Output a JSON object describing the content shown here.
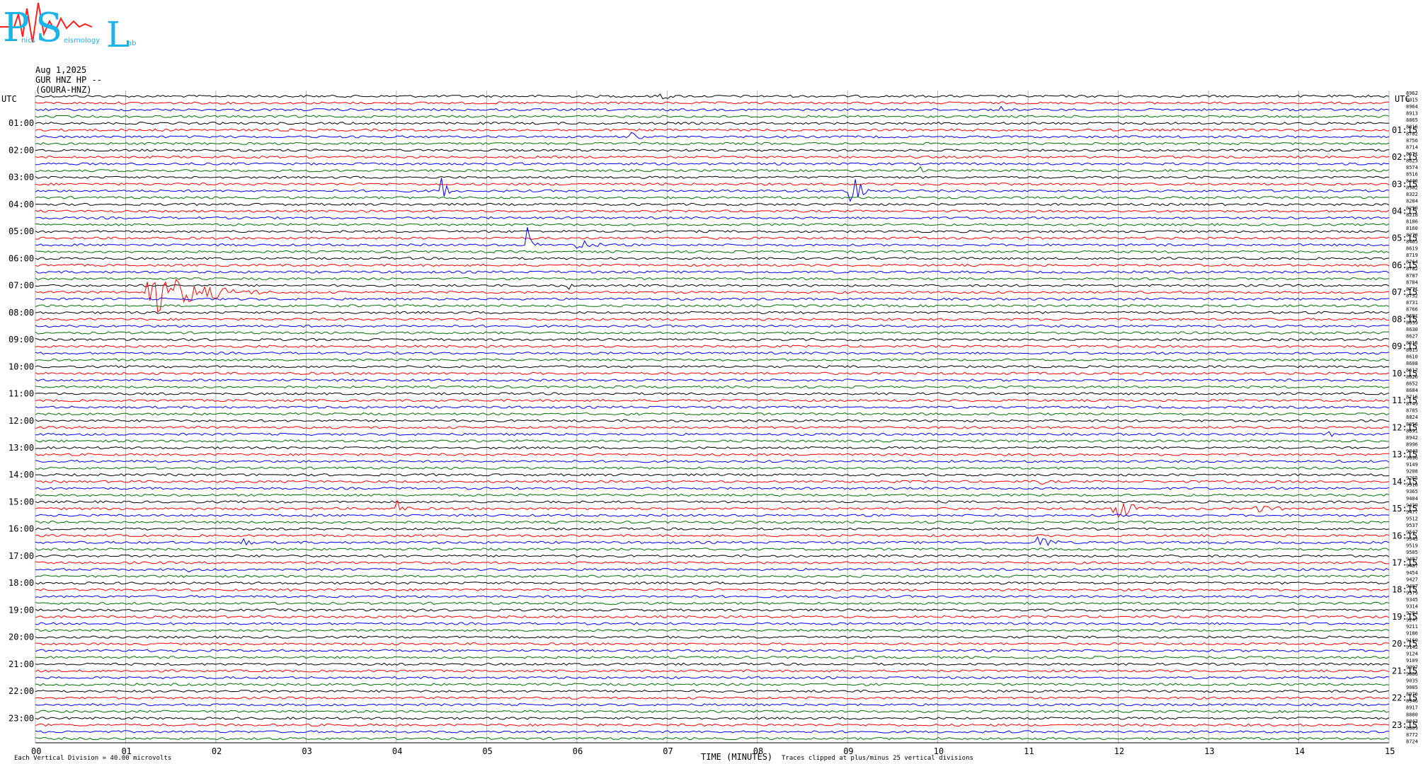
{
  "header": {
    "date": "Aug 1,2025",
    "channel": "GUR HNZ HP --",
    "station": "(GOURA-HNZ)"
  },
  "logo": {
    "letters": [
      "P",
      "S",
      "L"
    ],
    "text_fragment_1": "nics",
    "text_fragment_2": "eismology",
    "text_fragment_3": "ab"
  },
  "footer": {
    "division_note": "Each Vertical Division =    40.00 microvolts",
    "time_label": "TIME (MINUTES)",
    "clip_note": "Traces clipped at plus/minus 25 vertical divisions"
  },
  "colors": {
    "trace_cycle": [
      "#000000",
      "#ff0000",
      "#0000ff",
      "#007000"
    ],
    "grid": "#a0a0a0"
  },
  "chart_data": {
    "type": "line",
    "title": "",
    "xlabel": "TIME (MINUTES)",
    "xlim": [
      0,
      15
    ],
    "x_ticks": [
      "00",
      "01",
      "02",
      "03",
      "04",
      "05",
      "06",
      "07",
      "08",
      "09",
      "10",
      "11",
      "12",
      "13",
      "14",
      "15"
    ],
    "left_axis_label": "UTC",
    "right_axis_label": "UTC",
    "left_hour_labels": [
      "01:00",
      "02:00",
      "03:00",
      "04:00",
      "05:00",
      "06:00",
      "07:00",
      "08:00",
      "09:00",
      "10:00",
      "11:00",
      "12:00",
      "13:00",
      "14:00",
      "15:00",
      "16:00",
      "17:00",
      "18:00",
      "19:00",
      "20:00",
      "21:00",
      "22:00",
      "23:00"
    ],
    "right_hour_labels": [
      "01:15",
      "02:15",
      "03:15",
      "04:15",
      "05:15",
      "06:15",
      "07:15",
      "08:15",
      "09:15",
      "10:15",
      "11:15",
      "12:15",
      "13:15",
      "14:15",
      "15:15",
      "16:15",
      "17:15",
      "18:15",
      "19:15",
      "20:15",
      "21:15",
      "22:15",
      "23:15"
    ],
    "trace_count": 96,
    "trace_minutes": 15,
    "right_counts": [
      "8962",
      "9015",
      "8964",
      "8913",
      "8865",
      "8816",
      "8782",
      "8756",
      "8714",
      "8671",
      "8623",
      "8574",
      "8516",
      "8440",
      "8382",
      "8322",
      "8284",
      "8250",
      "8218",
      "8186",
      "8160",
      "8278",
      "8465",
      "8619",
      "8719",
      "8764",
      "8782",
      "8787",
      "8784",
      "8771",
      "8752",
      "8731",
      "8766",
      "8681",
      "8659",
      "8630",
      "8627",
      "8615",
      "8615",
      "8610",
      "8608",
      "8612",
      "8626",
      "8652",
      "8684",
      "8716",
      "8749",
      "8785",
      "8824",
      "8856",
      "8891",
      "8942",
      "8996",
      "9043",
      "9096",
      "9149",
      "9208",
      "9265",
      "9318",
      "9365",
      "9404",
      "9439",
      "9477",
      "9512",
      "9537",
      "9547",
      "9543",
      "9519",
      "9505",
      "9487",
      "9487",
      "9454",
      "9427",
      "9407",
      "9379",
      "9345",
      "9314",
      "9284",
      "9247",
      "9211",
      "9186",
      "9169",
      "9142",
      "9124",
      "9109",
      "9097",
      "9066",
      "9035",
      "9005",
      "8976",
      "8946",
      "8917",
      "8880",
      "8843",
      "8809",
      "8772",
      "8724"
    ],
    "events": [
      {
        "trace": 0,
        "minute": 6.9,
        "duration": 0.35,
        "amp": 9
      },
      {
        "trace": 2,
        "minute": 10.7,
        "duration": 0.2,
        "amp": 5
      },
      {
        "trace": 6,
        "minute": 6.6,
        "duration": 0.35,
        "amp": 7
      },
      {
        "trace": 11,
        "minute": 9.8,
        "duration": 0.25,
        "amp": 6
      },
      {
        "trace": 14,
        "minute": 9.0,
        "duration": 0.25,
        "amp": 70
      },
      {
        "trace": 14,
        "minute": 4.5,
        "duration": 0.15,
        "amp": 30
      },
      {
        "trace": 14,
        "minute": 8.5,
        "duration": 0.2,
        "amp": 6
      },
      {
        "trace": 22,
        "minute": 5.45,
        "duration": 0.15,
        "amp": 30
      },
      {
        "trace": 22,
        "minute": 6.0,
        "duration": 0.6,
        "amp": 10
      },
      {
        "trace": 28,
        "minute": 5.9,
        "duration": 0.15,
        "amp": 14
      },
      {
        "trace": 29,
        "minute": 1.2,
        "duration": 1.5,
        "amp": 40
      },
      {
        "trace": 50,
        "minute": 14.3,
        "duration": 0.25,
        "amp": 7
      },
      {
        "trace": 57,
        "minute": 11.1,
        "duration": 0.4,
        "amp": 6
      },
      {
        "trace": 61,
        "minute": 4.0,
        "duration": 0.25,
        "amp": 16
      },
      {
        "trace": 62,
        "minute": 10.6,
        "duration": 0.2,
        "amp": 5
      },
      {
        "trace": 61,
        "minute": 11.9,
        "duration": 0.5,
        "amp": 30
      },
      {
        "trace": 61,
        "minute": 13.5,
        "duration": 1.0,
        "amp": 6
      },
      {
        "trace": 66,
        "minute": 2.3,
        "duration": 0.3,
        "amp": 8
      },
      {
        "trace": 66,
        "minute": 11.1,
        "duration": 0.4,
        "amp": 16
      },
      {
        "trace": 70,
        "minute": 1.7,
        "duration": 0.3,
        "amp": 6
      },
      {
        "trace": 70,
        "minute": 8.8,
        "duration": 0.3,
        "amp": 6
      },
      {
        "trace": 73,
        "minute": 2.8,
        "duration": 0.3,
        "amp": 4
      },
      {
        "trace": 74,
        "minute": 8.8,
        "duration": 0.3,
        "amp": 8
      },
      {
        "trace": 76,
        "minute": 4.2,
        "duration": 0.2,
        "amp": 4
      }
    ]
  }
}
